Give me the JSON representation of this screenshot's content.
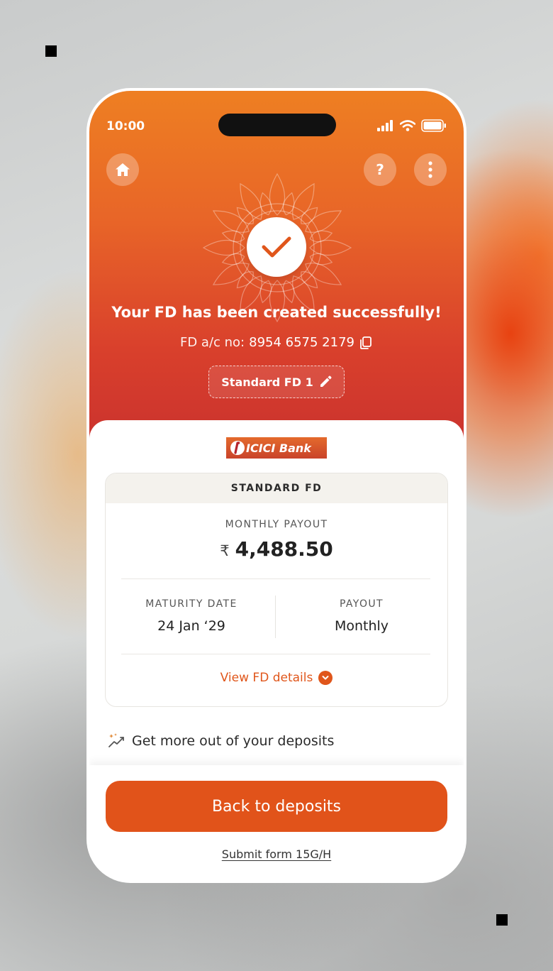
{
  "status_bar": {
    "time": "10:00"
  },
  "hero": {
    "title": "Your FD has been created successfully!",
    "account_label": "FD a/c no:",
    "account_number": "8954 6575 2179",
    "fd_name": "Standard FD 1"
  },
  "bank": {
    "logo_text": "ICICI Bank"
  },
  "fd_card": {
    "header": "STANDARD FD",
    "monthly_label": "MONTHLY PAYOUT",
    "currency": "₹",
    "monthly_value": "4,488.50",
    "maturity_label": "MATURITY DATE",
    "maturity_value": "24 Jan ‘29",
    "payout_label": "PAYOUT",
    "payout_value": "Monthly",
    "view_details": "View FD details"
  },
  "more_section": {
    "title": "Get more out of your deposits"
  },
  "footer": {
    "primary_button": "Back to deposits",
    "secondary_link": "Submit form 15G/H"
  },
  "colors": {
    "accent": "#e1531a",
    "hero_top": "#ee7f22",
    "hero_bottom": "#c8302e",
    "card_header_bg": "#f4f2ed"
  }
}
